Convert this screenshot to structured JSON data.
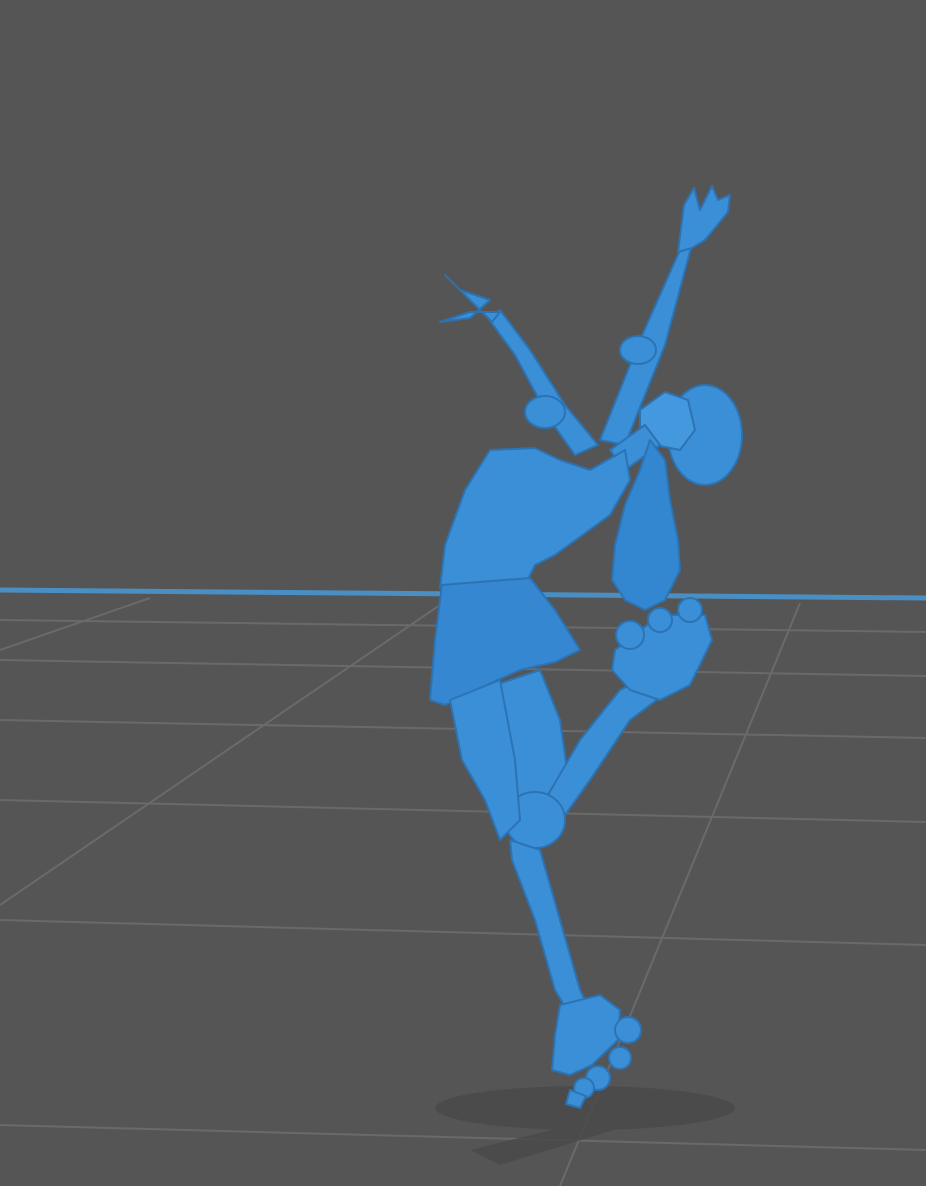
{
  "viewport": {
    "name": "3d-viewport",
    "background_color": "#555555",
    "grid_line_color": "#6a6a6a",
    "horizon_line_color": "#4a8fc4"
  },
  "model": {
    "name": "roller-skater-figure",
    "color": "#3a8fd6",
    "shade_color": "#2c73b3",
    "highlight_color": "#5aa8ea"
  },
  "shadow": {
    "color": "#4a4a4a"
  }
}
